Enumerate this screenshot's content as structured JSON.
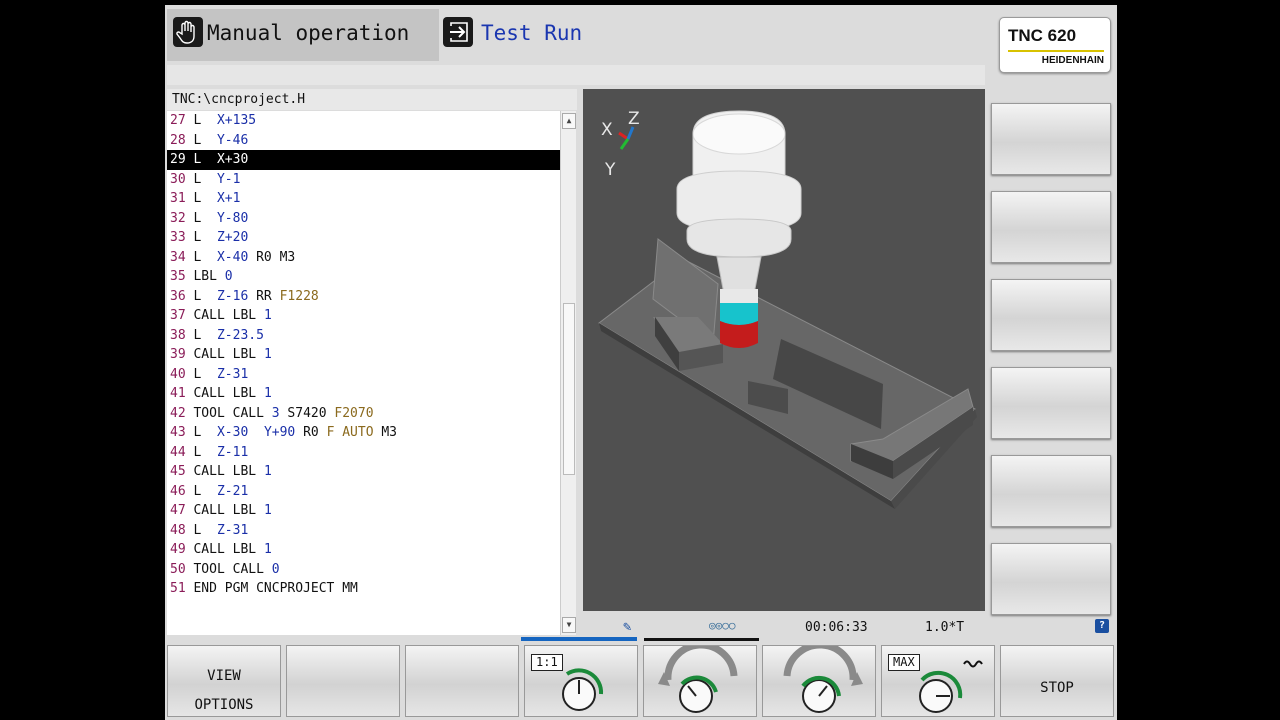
{
  "header": {
    "manual_mode": "Manual operation",
    "test_mode": "Test Run",
    "logo_model": "TNC 620",
    "logo_brand": "HEIDENHAIN"
  },
  "program": {
    "path": "TNC:\\cncproject.H",
    "selected_line": 29,
    "lines": [
      {
        "n": "27",
        "t": [
          [
            "kw",
            "L  "
          ],
          [
            "val",
            "X+135"
          ]
        ]
      },
      {
        "n": "28",
        "t": [
          [
            "kw",
            "L  "
          ],
          [
            "val",
            "Y-46"
          ]
        ]
      },
      {
        "n": "29",
        "t": [
          [
            "kw",
            "L  "
          ],
          [
            "val",
            "X+30"
          ]
        ]
      },
      {
        "n": "30",
        "t": [
          [
            "kw",
            "L  "
          ],
          [
            "val",
            "Y-1"
          ]
        ]
      },
      {
        "n": "31",
        "t": [
          [
            "kw",
            "L  "
          ],
          [
            "val",
            "X+1"
          ]
        ]
      },
      {
        "n": "32",
        "t": [
          [
            "kw",
            "L  "
          ],
          [
            "val",
            "Y-80"
          ]
        ]
      },
      {
        "n": "33",
        "t": [
          [
            "kw",
            "L  "
          ],
          [
            "val",
            "Z+20"
          ]
        ]
      },
      {
        "n": "34",
        "t": [
          [
            "kw",
            "L  "
          ],
          [
            "val",
            "X-40"
          ],
          [
            "kw",
            " R0 M3"
          ]
        ]
      },
      {
        "n": "35",
        "t": [
          [
            "kw",
            "LBL "
          ],
          [
            "val",
            "0"
          ]
        ]
      },
      {
        "n": "36",
        "t": [
          [
            "kw",
            "L  "
          ],
          [
            "val",
            "Z-16"
          ],
          [
            "kw",
            " RR "
          ],
          [
            "feed",
            "F1228"
          ]
        ]
      },
      {
        "n": "37",
        "t": [
          [
            "kw",
            "CALL LBL "
          ],
          [
            "val",
            "1"
          ]
        ]
      },
      {
        "n": "38",
        "t": [
          [
            "kw",
            "L  "
          ],
          [
            "val",
            "Z-23.5"
          ]
        ]
      },
      {
        "n": "39",
        "t": [
          [
            "kw",
            "CALL LBL "
          ],
          [
            "val",
            "1"
          ]
        ]
      },
      {
        "n": "40",
        "t": [
          [
            "kw",
            "L  "
          ],
          [
            "val",
            "Z-31"
          ]
        ]
      },
      {
        "n": "41",
        "t": [
          [
            "kw",
            "CALL LBL "
          ],
          [
            "val",
            "1"
          ]
        ]
      },
      {
        "n": "42",
        "t": [
          [
            "kw",
            "TOOL CALL "
          ],
          [
            "val",
            "3"
          ],
          [
            "kw",
            " S7420 "
          ],
          [
            "feed",
            "F2070"
          ]
        ]
      },
      {
        "n": "43",
        "t": [
          [
            "kw",
            "L  "
          ],
          [
            "val",
            "X-30"
          ],
          [
            "kw",
            "  "
          ],
          [
            "val",
            "Y+90"
          ],
          [
            "kw",
            " R0 "
          ],
          [
            "feed",
            "F AUTO"
          ],
          [
            "kw",
            " M3"
          ]
        ]
      },
      {
        "n": "44",
        "t": [
          [
            "kw",
            "L  "
          ],
          [
            "val",
            "Z-11"
          ]
        ]
      },
      {
        "n": "45",
        "t": [
          [
            "kw",
            "CALL LBL "
          ],
          [
            "val",
            "1"
          ]
        ]
      },
      {
        "n": "46",
        "t": [
          [
            "kw",
            "L  "
          ],
          [
            "val",
            "Z-21"
          ]
        ]
      },
      {
        "n": "47",
        "t": [
          [
            "kw",
            "CALL LBL "
          ],
          [
            "val",
            "1"
          ]
        ]
      },
      {
        "n": "48",
        "t": [
          [
            "kw",
            "L  "
          ],
          [
            "val",
            "Z-31"
          ]
        ]
      },
      {
        "n": "49",
        "t": [
          [
            "kw",
            "CALL LBL "
          ],
          [
            "val",
            "1"
          ]
        ]
      },
      {
        "n": "50",
        "t": [
          [
            "kw",
            "TOOL CALL "
          ],
          [
            "val",
            "0"
          ]
        ]
      },
      {
        "n": "51",
        "t": [
          [
            "kw",
            "END PGM CNCPROJECT MM"
          ]
        ]
      }
    ]
  },
  "simulation": {
    "axes": {
      "x": "X",
      "y": "Y",
      "z": "Z"
    },
    "run_time": "00:06:33",
    "factor": "1.0*T",
    "help": "?",
    "colors": {
      "background": "#505050",
      "tool_body": "#f0f0f0",
      "tool_cyan": "#17c3cc",
      "tool_red": "#c41c1c",
      "workpiece": "#6a6a6a"
    }
  },
  "softkeys": {
    "view_options_line1": "VIEW",
    "view_options_line2": "OPTIONS",
    "scale_tag": "1:1",
    "max_tag": "MAX",
    "stop": "STOP"
  }
}
